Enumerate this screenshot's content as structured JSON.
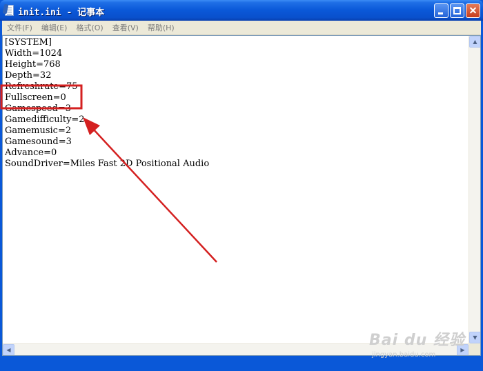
{
  "window": {
    "title": "init.ini - 记事本",
    "buttons": {
      "minimize": "minimize",
      "maximize": "maximize",
      "close": "close"
    }
  },
  "menubar": {
    "items": [
      {
        "label": "文件(F)"
      },
      {
        "label": "编辑(E)"
      },
      {
        "label": "格式(O)"
      },
      {
        "label": "查看(V)"
      },
      {
        "label": "帮助(H)"
      }
    ]
  },
  "document": {
    "lines": [
      "[SYSTEM]",
      "Width=1024",
      "Height=768",
      "Depth=32",
      "Refreshrate=75",
      "Fullscreen=0",
      "Gamespeed=3",
      "Gamedifficulty=2",
      "Gamemusic=2",
      "Gamesound=3",
      "Advance=0",
      "SoundDriver=Miles Fast 2D Positional Audio"
    ]
  },
  "annotation": {
    "color": "#d42020",
    "highlighted_line": "Fullscreen=0"
  },
  "watermark": {
    "logo": "Bai du 经验",
    "url": "jingyan.baidu.com"
  },
  "colors": {
    "titlebar": "#0a58d8",
    "menubar": "#ece9d8",
    "close_button": "#c63d1d"
  }
}
